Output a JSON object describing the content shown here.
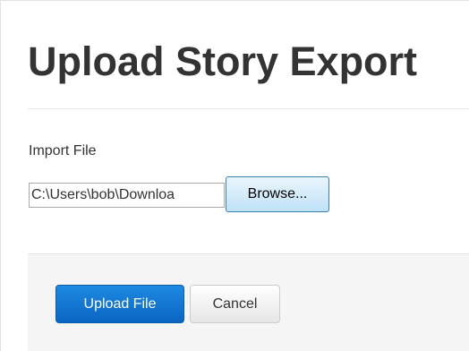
{
  "header": {
    "title": "Upload Story Export"
  },
  "form": {
    "import_file_label": "Import File",
    "file_path_value": "C:\\Users\\bob\\Downloa",
    "browse_label": "Browse..."
  },
  "footer": {
    "upload_label": "Upload File",
    "cancel_label": "Cancel"
  },
  "colors": {
    "primary_button": "#0a6fd1",
    "browse_button_bg": "#cfe8f8",
    "footer_bg": "#f5f5f5",
    "title_text": "#333333"
  }
}
